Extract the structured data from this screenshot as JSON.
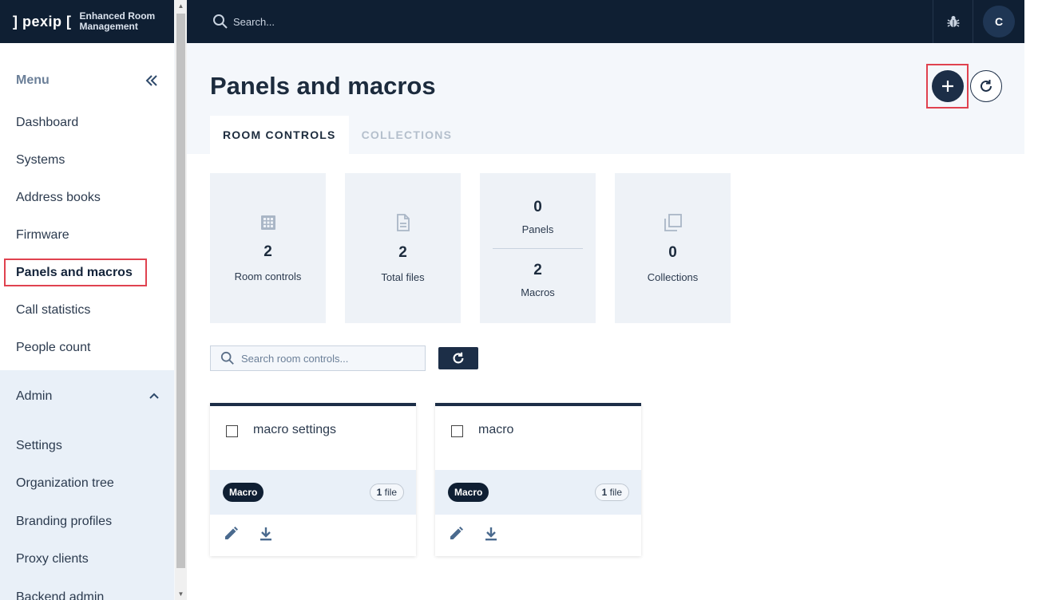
{
  "brand": {
    "logo": "] pexip [",
    "subtitle_line1": "Enhanced Room",
    "subtitle_line2": "Management"
  },
  "topbar": {
    "search_placeholder": "Search...",
    "avatar_initial": "C"
  },
  "sidebar": {
    "menu_title": "Menu",
    "items": [
      {
        "label": "Dashboard"
      },
      {
        "label": "Systems"
      },
      {
        "label": "Address books"
      },
      {
        "label": "Firmware"
      },
      {
        "label": "Panels and macros",
        "active": true
      },
      {
        "label": "Call statistics"
      },
      {
        "label": "People count"
      }
    ],
    "admin_title": "Admin",
    "admin_items": [
      {
        "label": "Settings"
      },
      {
        "label": "Organization tree"
      },
      {
        "label": "Branding profiles"
      },
      {
        "label": "Proxy clients"
      },
      {
        "label": "Backend admin"
      }
    ]
  },
  "main": {
    "title": "Panels and macros",
    "tabs": [
      {
        "label": "ROOM CONTROLS",
        "active": true
      },
      {
        "label": "COLLECTIONS",
        "active": false
      }
    ],
    "stats": {
      "room_controls": {
        "value": "2",
        "label": "Room controls",
        "icon": "grid-icon"
      },
      "total_files": {
        "value": "2",
        "label": "Total files",
        "icon": "file-icon"
      },
      "panels": {
        "value": "0",
        "label": "Panels"
      },
      "macros": {
        "value": "2",
        "label": "Macros"
      },
      "collections": {
        "value": "0",
        "label": "Collections",
        "icon": "copy-icon"
      }
    },
    "search_placeholder": "Search room controls...",
    "cards": [
      {
        "title": "macro settings",
        "badge": "Macro",
        "file_count": "1",
        "file_label": "file"
      },
      {
        "title": "macro",
        "badge": "Macro",
        "file_count": "1",
        "file_label": "file"
      }
    ]
  },
  "colors": {
    "navy": "#0f1f33",
    "accent_red": "#e0424f",
    "panel_bg": "#eef2f7"
  }
}
